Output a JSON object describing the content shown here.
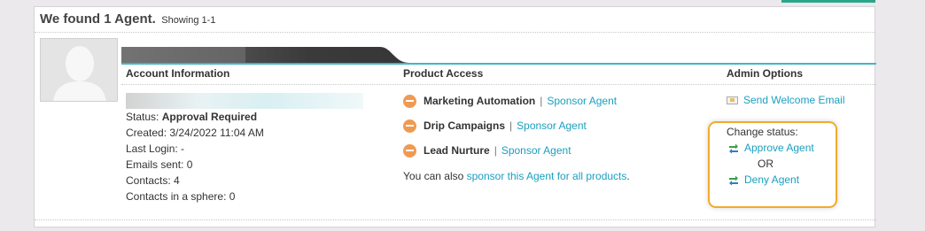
{
  "results": {
    "title": "We found 1 Agent.",
    "showing": "Showing 1-1"
  },
  "columns": {
    "account": "Account Information",
    "product": "Product Access",
    "admin": "Admin Options"
  },
  "account": {
    "status_label": "Status:",
    "status_value": "Approval Required",
    "created": "Created: 3/24/2022 11:04 AM",
    "last_login": "Last Login: -",
    "emails_sent": "Emails sent: 0",
    "contacts": "Contacts: 4",
    "contacts_sphere": "Contacts in a sphere: 0"
  },
  "products": [
    {
      "name": "Marketing Automation",
      "action": "Sponsor Agent"
    },
    {
      "name": "Drip Campaigns",
      "action": "Sponsor Agent"
    },
    {
      "name": "Lead Nurture",
      "action": "Sponsor Agent"
    }
  ],
  "sponsor_all": {
    "prefix": "You can also",
    "link": "sponsor this Agent for all products",
    "suffix": "."
  },
  "admin": {
    "send_welcome": "Send Welcome Email",
    "change_status": "Change status:",
    "approve": "Approve Agent",
    "or": "OR",
    "deny": "Deny Agent"
  },
  "colors": {
    "link": "#1a9fc0",
    "accent_teal": "#3fb6c8",
    "product_icon": "#ef9a53",
    "highlight_border": "#f0ac2a"
  }
}
